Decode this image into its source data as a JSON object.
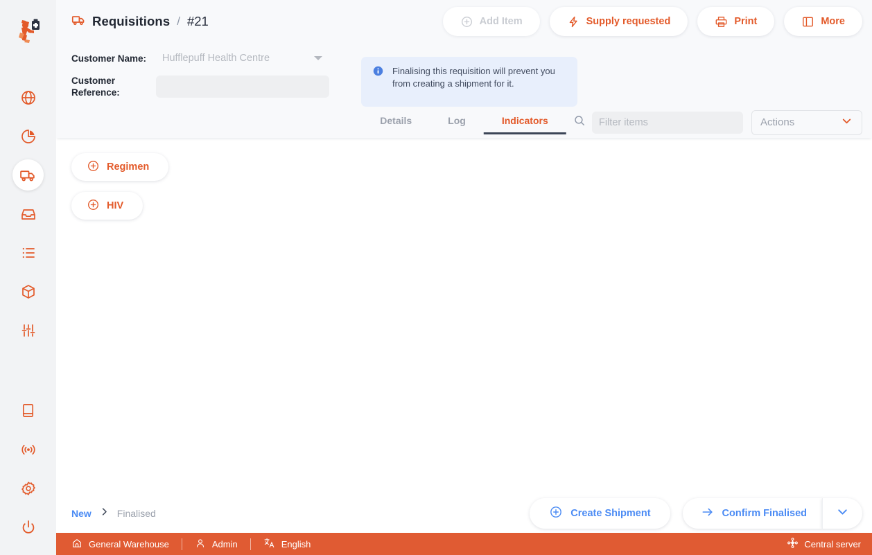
{
  "sidebar": {
    "logo_name": "msupply-runner-logo",
    "top_items": [
      {
        "icon": "globe-icon",
        "name": "sidebar-item-dashboard",
        "active": false
      },
      {
        "icon": "pie-chart-icon",
        "name": "sidebar-item-reports",
        "active": false
      },
      {
        "icon": "truck-icon",
        "name": "sidebar-item-distribution",
        "active": true
      },
      {
        "icon": "inbox-icon",
        "name": "sidebar-item-replenishment",
        "active": false
      },
      {
        "icon": "list-icon",
        "name": "sidebar-item-catalogue",
        "active": false
      },
      {
        "icon": "package-icon",
        "name": "sidebar-item-inventory",
        "active": false
      },
      {
        "icon": "sliders-icon",
        "name": "sidebar-item-tools",
        "active": false
      }
    ],
    "bottom_items": [
      {
        "icon": "book-icon",
        "name": "sidebar-item-manual",
        "active": false
      },
      {
        "icon": "broadcast-icon",
        "name": "sidebar-item-sync",
        "active": false
      },
      {
        "icon": "gear-icon",
        "name": "sidebar-item-settings",
        "active": false
      },
      {
        "icon": "power-icon",
        "name": "sidebar-item-logout",
        "active": false
      }
    ]
  },
  "header": {
    "title": "Requisitions",
    "separator": "/",
    "record_id": "#21",
    "actions": [
      {
        "label": "Add Item",
        "icon": "plus-circle-icon",
        "disabled": true
      },
      {
        "label": "Supply requested",
        "icon": "bolt-icon",
        "disabled": false
      },
      {
        "label": "Print",
        "icon": "printer-icon",
        "disabled": false
      },
      {
        "label": "More",
        "icon": "panel-icon",
        "disabled": false
      }
    ]
  },
  "form": {
    "customer_name_label": "Customer Name:",
    "customer_name_value": "Hufflepuff Health Centre",
    "customer_reference_label": "Customer Reference:",
    "customer_reference_value": "",
    "customer_reference_placeholder": ""
  },
  "banner": {
    "icon": "info-icon",
    "text": "Finalising this requisition will prevent you from creating a shipment for it."
  },
  "search": {
    "icon": "search-icon",
    "placeholder": "Filter items",
    "value": ""
  },
  "actions_dropdown": {
    "label": "Actions",
    "icon": "chevron-down-icon"
  },
  "tabs": [
    {
      "label": "Details",
      "active": false
    },
    {
      "label": "Log",
      "active": false
    },
    {
      "label": "Indicators",
      "active": true
    }
  ],
  "content": {
    "chips": [
      {
        "label": "Regimen",
        "icon": "plus-circle-icon"
      },
      {
        "label": "HIV",
        "icon": "plus-circle-icon"
      }
    ]
  },
  "footer": {
    "status_current": "New",
    "status_next": "Finalised",
    "chevron_icon": "chevron-right-icon",
    "create_shipment": {
      "label": "Create Shipment",
      "icon": "plus-circle-icon"
    },
    "confirm": {
      "label": "Confirm Finalised",
      "icon": "arrow-right-icon",
      "dropdown_icon": "chevron-down-icon"
    }
  },
  "statusbar": {
    "store": {
      "label": "General Warehouse",
      "icon": "home-icon"
    },
    "user": {
      "label": "Admin",
      "icon": "person-icon"
    },
    "language": {
      "label": "English",
      "icon": "translate-icon"
    },
    "server": {
      "label": "Central server",
      "icon": "network-icon"
    }
  },
  "colors": {
    "accent_orange": "#e35a2a",
    "statusbar_orange": "#e05b33",
    "blue": "#4b8bf4",
    "info_bg": "#e8effc",
    "header_bg": "#f8f9fb",
    "sidebar_bg": "#f2f3f5"
  }
}
